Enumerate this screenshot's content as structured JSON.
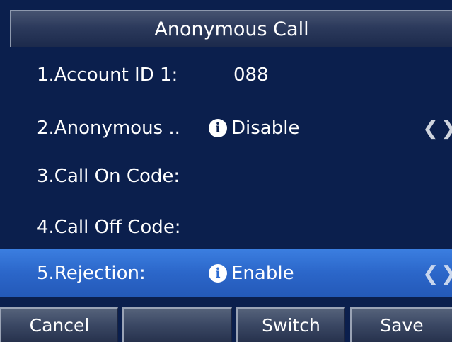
{
  "title": "Anonymous Call",
  "rows": [
    {
      "label": "1.Account ID 1:",
      "value": "088",
      "info": false,
      "arrows": false
    },
    {
      "label": "2.Anonymous ..",
      "value": "Disable",
      "info": true,
      "arrows": true
    },
    {
      "label": "3.Call On Code:",
      "value": "",
      "info": false,
      "arrows": false
    },
    {
      "label": "4.Call Off Code:",
      "value": "",
      "info": false,
      "arrows": false
    },
    {
      "label": "5.Rejection:",
      "value": "Enable",
      "info": true,
      "arrows": true
    }
  ],
  "info_glyph": "i",
  "arrow_glyphs": "❮❯",
  "selected_row": 5,
  "softkeys": {
    "key1": "Cancel",
    "key2": "",
    "key3": "Switch",
    "key4": "Save"
  },
  "colors": {
    "background": "#0b1f4d",
    "selection": "#2b66c9",
    "text": "#ffffff"
  }
}
